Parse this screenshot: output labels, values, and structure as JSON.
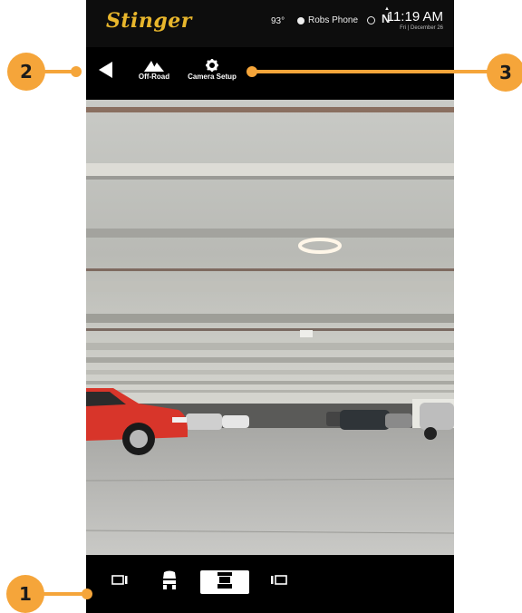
{
  "status_bar": {
    "brand": "Stinger",
    "temperature": "93°",
    "phone_name": "Robs Phone",
    "nav_letter": "N",
    "time": "11:19 AM",
    "date": "Fri | December 26"
  },
  "toolbar": {
    "offroad_label": "Off-Road",
    "camera_setup_label": "Camera Setup"
  },
  "bottom_bar": {
    "views": [
      "rear-side-view-icon",
      "car-front-view-icon",
      "car-top-view-icon",
      "side-right-view-icon"
    ],
    "active_view_index": 2
  },
  "callouts": [
    "1",
    "2",
    "3"
  ],
  "colors": {
    "callout": "#f5a53a",
    "brand": "#e8b62c",
    "toolbar_bg": "#000000",
    "car": "#d8352a"
  }
}
